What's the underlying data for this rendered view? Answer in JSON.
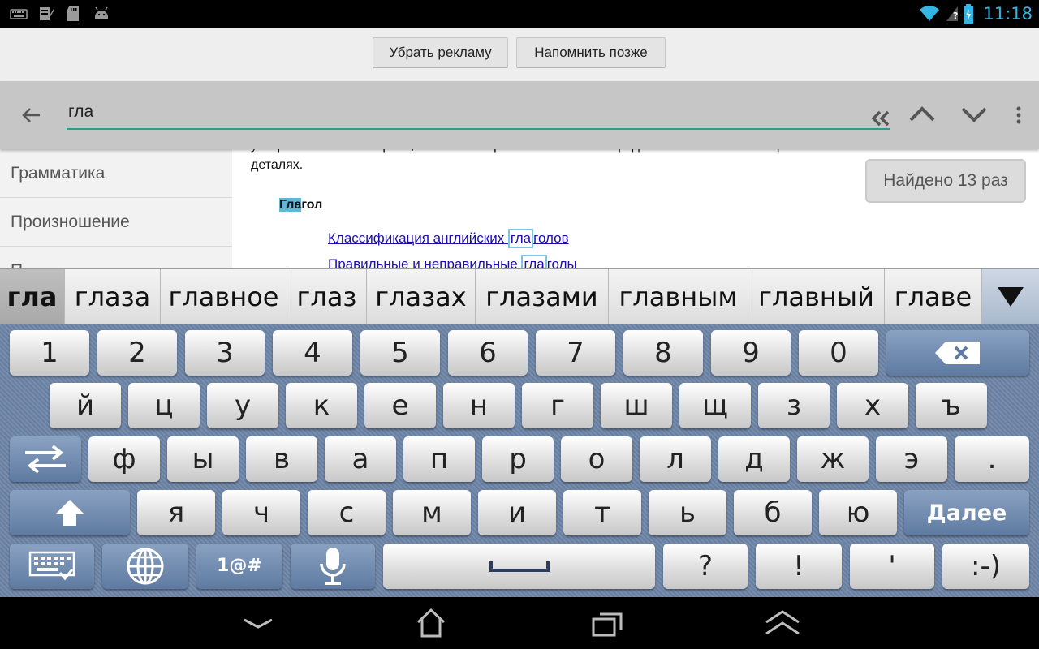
{
  "status_bar": {
    "time": "11:18",
    "icons": [
      "keyboard-icon",
      "clipboard-icon",
      "sd-card-icon",
      "android-icon",
      "wifi-icon",
      "signal-unknown-icon",
      "battery-charging-icon"
    ]
  },
  "ad_bar": {
    "remove_ads_label": "Убрать рекламу",
    "remind_later_label": "Напомнить позже"
  },
  "search": {
    "value": "гла",
    "back_icon": "back-arrow-icon",
    "buttons": [
      "collapse-icon",
      "previous-match-icon",
      "next-match-icon",
      "overflow-menu-icon"
    ]
  },
  "sidebar": {
    "items": [
      {
        "label": "Грамматика"
      },
      {
        "label": "Произношение"
      },
      {
        "label": "П"
      }
    ]
  },
  "content": {
    "intro_line1": "употребления частей речи, а также построения английских предложений. Английская грамматика в",
    "intro_line2": "деталях.",
    "heading_match": "Гла",
    "heading_rest": "гол",
    "link1_before": "Классификация английских ",
    "link1_match": "гла",
    "link1_after": "голов",
    "link2_before": "Правильные и неправильные ",
    "link2_match": "гла",
    "link2_after": "голы"
  },
  "found_badge": "Найдено 13 раз",
  "suggestions": [
    "гла",
    "глаза",
    "главное",
    "глаз",
    "глазах",
    "глазами",
    "главным",
    "главный",
    "главе"
  ],
  "keyboard": {
    "row1": [
      "1",
      "2",
      "3",
      "4",
      "5",
      "6",
      "7",
      "8",
      "9",
      "0"
    ],
    "row2": [
      "й",
      "ц",
      "у",
      "к",
      "е",
      "н",
      "г",
      "ш",
      "щ",
      "з",
      "х",
      "ъ"
    ],
    "row3": [
      "ф",
      "ы",
      "в",
      "а",
      "п",
      "р",
      "о",
      "л",
      "д",
      "ж",
      "э",
      "."
    ],
    "row4": [
      "я",
      "ч",
      "с",
      "м",
      "и",
      "т",
      "ь",
      "б",
      "ю"
    ],
    "enter_label": "Далее",
    "symbols_label": "1@#",
    "row5_keys": [
      "?",
      "!",
      "'",
      ":-)"
    ]
  },
  "nav_bar": {
    "buttons": [
      "hide-keyboard-icon",
      "home-icon",
      "recent-apps-icon",
      "menu-up-icon"
    ]
  }
}
